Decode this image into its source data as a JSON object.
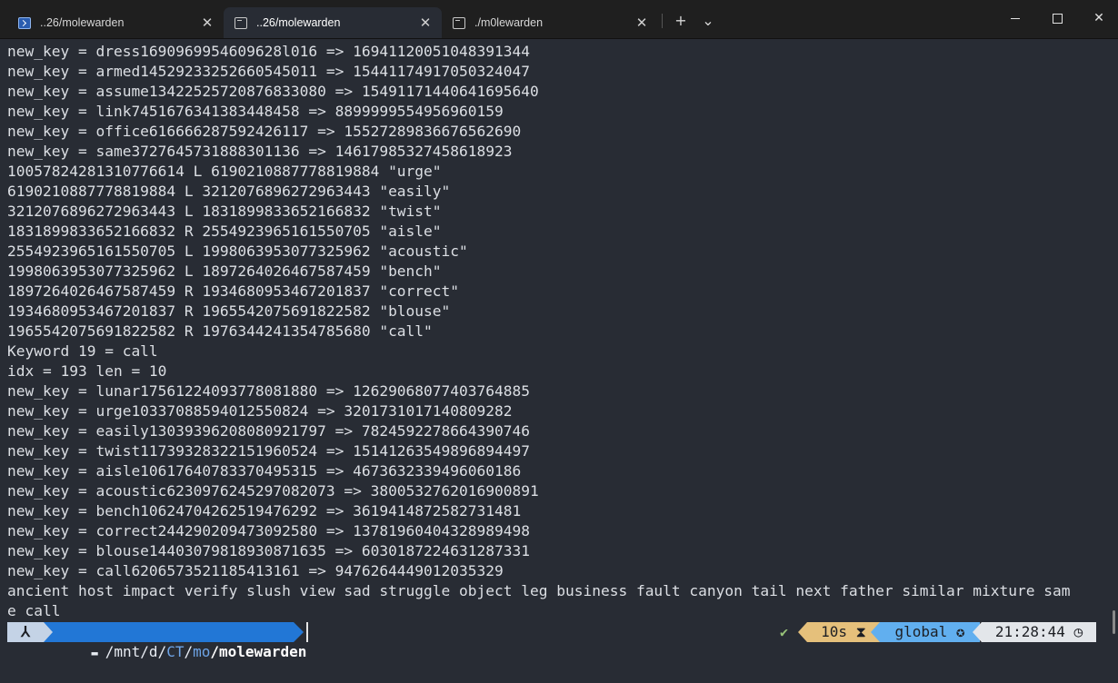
{
  "tabs": [
    {
      "label": "..26/molewarden",
      "icon": "powershell-icon"
    },
    {
      "label": "..26/molewarden",
      "icon": "terminal-icon"
    },
    {
      "label": "./m0lewarden",
      "icon": "terminal-icon"
    }
  ],
  "tabbar": {
    "new_tab": "+",
    "dropdown": "⌄",
    "close": "✕"
  },
  "window": {
    "minimize": "",
    "maximize": "",
    "close": "✕"
  },
  "terminal_lines": [
    "new_key = dress1690969954609628l016 => 16941120051048391344",
    "new_key = armed14529233252660545011 => 15441174917050324047",
    "new_key = assume13422525720876833080 => 15491171440641695640",
    "new_key = link7451676341383448458 => 8899999554956960159",
    "new_key = office616666287592426117 => 15527289836676562690",
    "new_key = same3727645731888301136 => 14617985327458618923",
    "10057824281310776614 L 6190210887778819884 \"urge\"",
    "6190210887778819884 L 3212076896272963443 \"easily\"",
    "3212076896272963443 L 1831899833652166832 \"twist\"",
    "1831899833652166832 R 2554923965161550705 \"aisle\"",
    "2554923965161550705 L 1998063953077325962 \"acoustic\"",
    "1998063953077325962 L 1897264026467587459 \"bench\"",
    "1897264026467587459 R 1934680953467201837 \"correct\"",
    "1934680953467201837 R 1965542075691822582 \"blouse\"",
    "1965542075691822582 R 1976344241354785680 \"call\"",
    "Keyword 19 = call",
    "idx = 193 len = 10",
    "new_key = lunar17561224093778081880 => 12629068077403764885",
    "new_key = urge10337088594012550824 => 3201731017140809282",
    "new_key = easily13039396208080921797 => 7824592278664390746",
    "new_key = twist11739328322151960524 => 15141263549896894497",
    "new_key = aisle10617640783370495315 => 4673632339496060186",
    "new_key = acoustic6230976245297082073 => 3800532762016900891",
    "new_key = bench10624704262519476292 => 3619414872582731481",
    "new_key = correct244290209473092580 => 13781960404328989498",
    "new_key = blouse14403079818930871635 => 6030187224631287331",
    "new_key = call6206573521185413161 => 9476264449012035329",
    "ancient host impact verify slush view sad struggle object leg business fault canyon tail next father similar mixture sam",
    "e call"
  ],
  "prompt": {
    "os_glyph": "⅄",
    "path_prefix": "/mnt/d/",
    "path_dim_1": "CT",
    "path_sep": "/",
    "path_dim_2": "mo",
    "path_current": "/molewarden",
    "status_check": "✔",
    "elapsed": "10s ⧗",
    "env": "global ✪",
    "clock": "21:28:44 ◷"
  }
}
